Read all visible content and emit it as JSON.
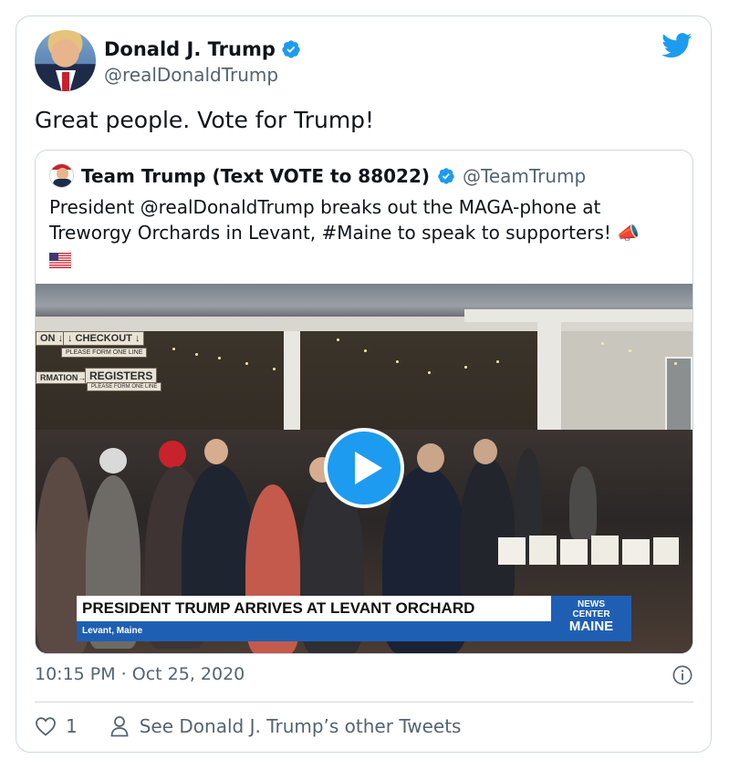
{
  "tweet": {
    "author_name": "Donald J. Trump",
    "author_handle": "@realDonaldTrump",
    "text": "Great people. Vote for Trump!",
    "timestamp": "10:15 PM · Oct 25, 2020",
    "like_count": "1",
    "other_tweets_label": "See Donald J. Trump’s other Tweets"
  },
  "quoted": {
    "author_name": "Team Trump (Text VOTE to 88022)",
    "author_handle": "@TeamTrump",
    "text": "President @realDonaldTrump breaks out the MAGA-phone at Treworgy Orchards in Levant, #Maine to speak to supporters! 📣",
    "video": {
      "signs": [
        "ON ↓",
        "↓ CHECKOUT ↓",
        "PLEASE FORM ONE LINE",
        "RMATION→",
        "REGISTERS",
        "PLEASE FORM ONE LINE"
      ],
      "lower_third_title": "PRESIDENT TRUMP ARRIVES AT LEVANT ORCHARD",
      "lower_third_location": "Levant, Maine",
      "logo_line1": "NEWS",
      "logo_line2": "CENTER",
      "logo_line3": "MAINE"
    }
  },
  "colors": {
    "twitter_blue": "#1d9bf0",
    "text_primary": "#0f1419",
    "text_secondary": "#536471",
    "border": "#cfd9de",
    "news_blue": "#1f5fb3"
  },
  "icons": [
    "twitter-bird-icon",
    "verified-badge-icon",
    "play-icon",
    "info-icon",
    "heart-icon",
    "person-icon",
    "us-flag-icon",
    "megaphone-icon"
  ]
}
